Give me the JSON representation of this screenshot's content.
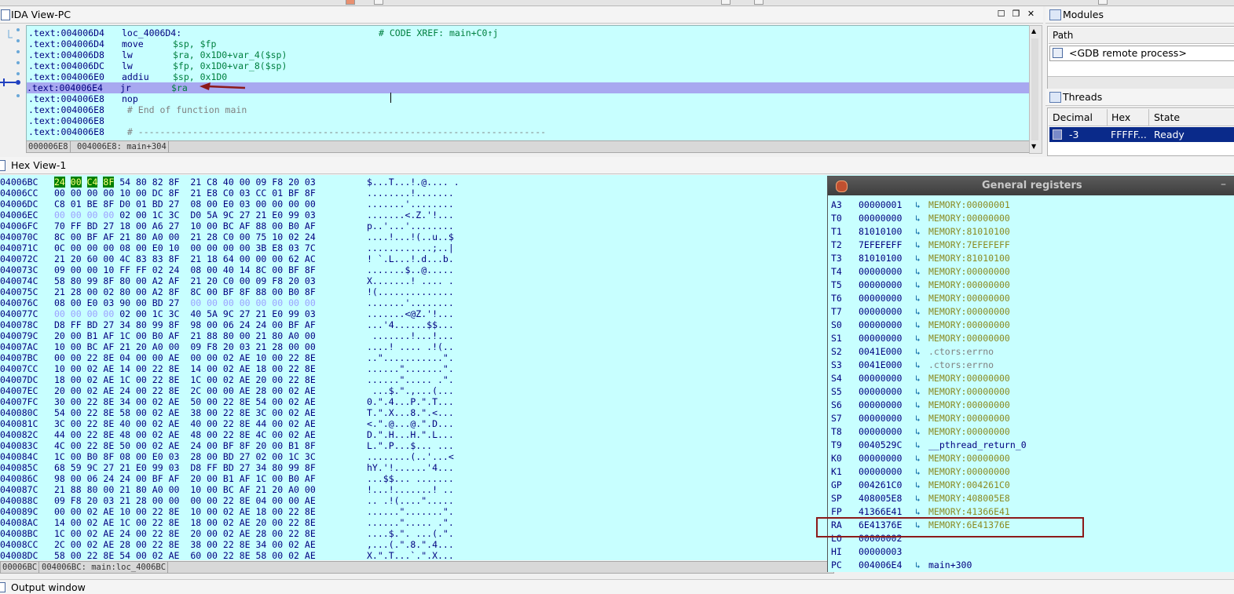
{
  "ida_view": {
    "title": "IDA View-PC",
    "lines": [
      {
        "addr": ".text:004006D4",
        "mnem": "loc_4006D4:",
        "ops": "",
        "comment": "# CODE XREF: main+C0↑j"
      },
      {
        "addr": ".text:004006D4",
        "mnem": "move",
        "ops": "$sp, $fp",
        "comment": ""
      },
      {
        "addr": ".text:004006D8",
        "mnem": "lw",
        "ops": "$ra, 0x1D0+var_4($sp)",
        "comment": ""
      },
      {
        "addr": ".text:004006DC",
        "mnem": "lw",
        "ops": "$fp, 0x1D0+var_8($sp)",
        "comment": ""
      },
      {
        "addr": ".text:004006E0",
        "mnem": "addiu",
        "ops": "$sp, 0x1D0",
        "comment": ""
      },
      {
        "addr": ".text:004006E4",
        "mnem": "jr",
        "ops": "$ra",
        "comment": ""
      },
      {
        "addr": ".text:004006E8",
        "mnem": "nop",
        "ops": "",
        "comment": ""
      },
      {
        "addr": ".text:004006E8",
        "mnem": "",
        "ops": "",
        "comment": " # End of function main"
      },
      {
        "addr": ".text:004006E8",
        "mnem": "",
        "ops": "",
        "comment": ""
      },
      {
        "addr": ".text:004006E8",
        "mnem": "",
        "ops": "",
        "comment": " # ---------------------------------------------------------------------------"
      }
    ],
    "selected_line": 5,
    "status": [
      "000006E8",
      "004006E8: main+304"
    ]
  },
  "modules": {
    "title": "Modules",
    "column": "Path",
    "rows": [
      "<GDB remote process>"
    ]
  },
  "threads": {
    "title": "Threads",
    "columns": [
      "Decimal",
      "Hex",
      "State"
    ],
    "rows": [
      {
        "decimal": "-3",
        "hex": "FFFFF...",
        "state": "Ready"
      }
    ]
  },
  "hex_view": {
    "title": "Hex View-1",
    "rows": [
      {
        "addr": "04006BC",
        "hex": "24 00 C4 8F 54 80 82 8F  21 C8 40 00 09 F8 20 03",
        "ascii": "$...T...!.@.... ."
      },
      {
        "addr": "04006CC",
        "hex": "00 00 00 00 10 00 DC 8F  21 E8 C0 03 CC 01 BF 8F",
        "ascii": "........!......."
      },
      {
        "addr": "04006DC",
        "hex": "C8 01 BE 8F D0 01 BD 27  08 00 E0 03 00 00 00 00",
        "ascii": ".......'........"
      },
      {
        "addr": "04006EC",
        "hex": "00 00 00 00 02 00 1C 3C  D0 5A 9C 27 21 E0 99 03",
        "ascii": ".......<.Z.'!..."
      },
      {
        "addr": "04006FC",
        "hex": "70 FF BD 27 18 00 A6 27  10 00 BC AF 88 00 B0 AF",
        "ascii": "p..'...'........"
      },
      {
        "addr": "040070C",
        "hex": "8C 00 BF AF 21 80 A0 00  21 28 C0 00 75 10 02 24",
        "ascii": "....!...!(..u..$"
      },
      {
        "addr": "040071C",
        "hex": "0C 00 00 00 08 00 E0 10  00 00 00 00 3B E8 03 7C",
        "ascii": "............;..|"
      },
      {
        "addr": "040072C",
        "hex": "21 20 60 00 4C 83 83 8F  21 18 64 00 00 00 62 AC",
        "ascii": "! `.L...!.d...b."
      },
      {
        "addr": "040073C",
        "hex": "09 00 00 10 FF FF 02 24  08 00 40 14 8C 00 BF 8F",
        "ascii": ".......$..@....."
      },
      {
        "addr": "040074C",
        "hex": "58 80 99 8F 80 00 A2 AF  21 20 C0 00 09 F8 20 03",
        "ascii": "X.......! .... ."
      },
      {
        "addr": "040075C",
        "hex": "21 28 00 02 80 00 A2 8F  8C 00 BF 8F 88 00 B0 8F",
        "ascii": "!(.............."
      },
      {
        "addr": "040076C",
        "hex": "08 00 E0 03 90 00 BD 27  00 00 00 00 00 00 00 00",
        "ascii": ".......'........"
      },
      {
        "addr": "040077C",
        "hex": "00 00 00 00 02 00 1C 3C  40 5A 9C 27 21 E0 99 03",
        "ascii": ".......<@Z.'!..."
      },
      {
        "addr": "040078C",
        "hex": "D8 FF BD 27 34 80 99 8F  98 00 06 24 24 00 BF AF",
        "ascii": "...'4......$$..."
      },
      {
        "addr": "040079C",
        "hex": "20 00 B1 AF 1C 00 B0 AF  21 88 80 00 21 80 A0 00",
        "ascii": " .......!...!..."
      },
      {
        "addr": "04007AC",
        "hex": "10 00 BC AF 21 20 A0 00  09 F8 20 03 21 28 00 00",
        "ascii": "....! .... .!(.."
      },
      {
        "addr": "04007BC",
        "hex": "00 00 22 8E 04 00 00 AE  00 00 02 AE 10 00 22 8E",
        "ascii": "..\"...........\"."
      },
      {
        "addr": "04007CC",
        "hex": "10 00 02 AE 14 00 22 8E  14 00 02 AE 18 00 22 8E",
        "ascii": "......\".......\"."
      },
      {
        "addr": "04007DC",
        "hex": "18 00 02 AE 1C 00 22 8E  1C 00 02 AE 20 00 22 8E",
        "ascii": "......\"..... .\"."
      },
      {
        "addr": "04007EC",
        "hex": "20 00 02 AE 24 00 22 8E  2C 00 00 AE 28 00 02 AE",
        "ascii": " ...$.\".,...(..."
      },
      {
        "addr": "04007FC",
        "hex": "30 00 22 8E 34 00 02 AE  50 00 22 8E 54 00 02 AE",
        "ascii": "0.\".4...P.\".T..."
      },
      {
        "addr": "040080C",
        "hex": "54 00 22 8E 58 00 02 AE  38 00 22 8E 3C 00 02 AE",
        "ascii": "T.\".X...8.\".<..."
      },
      {
        "addr": "040081C",
        "hex": "3C 00 22 8E 40 00 02 AE  40 00 22 8E 44 00 02 AE",
        "ascii": "<.\".@...@.\".D..."
      },
      {
        "addr": "040082C",
        "hex": "44 00 22 8E 48 00 02 AE  48 00 22 8E 4C 00 02 AE",
        "ascii": "D.\".H...H.\".L..."
      },
      {
        "addr": "040083C",
        "hex": "4C 00 22 8E 50 00 02 AE  24 00 BF 8F 20 00 B1 8F",
        "ascii": "L.\".P...$... ..."
      },
      {
        "addr": "040084C",
        "hex": "1C 00 B0 8F 08 00 E0 03  28 00 BD 27 02 00 1C 3C",
        "ascii": "........(..'...<"
      },
      {
        "addr": "040085C",
        "hex": "68 59 9C 27 21 E0 99 03  D8 FF BD 27 34 80 99 8F",
        "ascii": "hY.'!......'4..."
      },
      {
        "addr": "040086C",
        "hex": "98 00 06 24 24 00 BF AF  20 00 B1 AF 1C 00 B0 AF",
        "ascii": "...$$... ......."
      },
      {
        "addr": "040087C",
        "hex": "21 88 80 00 21 80 A0 00  10 00 BC AF 21 20 A0 00",
        "ascii": "!...!.......! .."
      },
      {
        "addr": "040088C",
        "hex": "09 F8 20 03 21 28 00 00  00 00 22 8E 04 00 00 AE",
        "ascii": ".. .!(....\"....."
      },
      {
        "addr": "040089C",
        "hex": "00 00 02 AE 10 00 22 8E  10 00 02 AE 18 00 22 8E",
        "ascii": "......\".......\"."
      },
      {
        "addr": "04008AC",
        "hex": "14 00 02 AE 1C 00 22 8E  18 00 02 AE 20 00 22 8E",
        "ascii": "......\"..... .\"."
      },
      {
        "addr": "04008BC",
        "hex": "1C 00 02 AE 24 00 22 8E  20 00 02 AE 28 00 22 8E",
        "ascii": "....$.\". ...(.\"."
      },
      {
        "addr": "04008CC",
        "hex": "2C 00 02 AE 28 00 22 8E  38 00 22 8E 34 00 02 AE",
        "ascii": ",...(.\".8.\".4..."
      },
      {
        "addr": "04008DC",
        "hex": "58 00 22 8E 54 00 02 AE  60 00 22 8E 58 00 02 AE",
        "ascii": "X.\".T...`.\".X..."
      }
    ],
    "status": [
      "00006BC",
      "004006BC: main:loc_4006BC"
    ]
  },
  "registers": {
    "title": "General registers",
    "rows": [
      {
        "name": "A3",
        "value": "00000001",
        "desc": "MEMORY:00000001",
        "kind": "mem"
      },
      {
        "name": "T0",
        "value": "00000000",
        "desc": "MEMORY:00000000",
        "kind": "mem"
      },
      {
        "name": "T1",
        "value": "81010100",
        "desc": "MEMORY:81010100",
        "kind": "mem"
      },
      {
        "name": "T2",
        "value": "7EFEFEFF",
        "desc": "MEMORY:7EFEFEFF",
        "kind": "mem"
      },
      {
        "name": "T3",
        "value": "81010100",
        "desc": "MEMORY:81010100",
        "kind": "mem"
      },
      {
        "name": "T4",
        "value": "00000000",
        "desc": "MEMORY:00000000",
        "kind": "mem"
      },
      {
        "name": "T5",
        "value": "00000000",
        "desc": "MEMORY:00000000",
        "kind": "mem"
      },
      {
        "name": "T6",
        "value": "00000000",
        "desc": "MEMORY:00000000",
        "kind": "mem"
      },
      {
        "name": "T7",
        "value": "00000000",
        "desc": "MEMORY:00000000",
        "kind": "mem"
      },
      {
        "name": "S0",
        "value": "00000000",
        "desc": "MEMORY:00000000",
        "kind": "mem"
      },
      {
        "name": "S1",
        "value": "00000000",
        "desc": "MEMORY:00000000",
        "kind": "mem"
      },
      {
        "name": "S2",
        "value": "0041E000",
        "desc": ".ctors:errno",
        "kind": "seg"
      },
      {
        "name": "S3",
        "value": "0041E000",
        "desc": ".ctors:errno",
        "kind": "seg"
      },
      {
        "name": "S4",
        "value": "00000000",
        "desc": "MEMORY:00000000",
        "kind": "mem"
      },
      {
        "name": "S5",
        "value": "00000000",
        "desc": "MEMORY:00000000",
        "kind": "mem"
      },
      {
        "name": "S6",
        "value": "00000000",
        "desc": "MEMORY:00000000",
        "kind": "mem"
      },
      {
        "name": "S7",
        "value": "00000000",
        "desc": "MEMORY:00000000",
        "kind": "mem"
      },
      {
        "name": "T8",
        "value": "00000000",
        "desc": "MEMORY:00000000",
        "kind": "mem"
      },
      {
        "name": "T9",
        "value": "0040529C",
        "desc": "__pthread_return_0",
        "kind": "sym"
      },
      {
        "name": "K0",
        "value": "00000000",
        "desc": "MEMORY:00000000",
        "kind": "mem"
      },
      {
        "name": "K1",
        "value": "00000000",
        "desc": "MEMORY:00000000",
        "kind": "mem"
      },
      {
        "name": "GP",
        "value": "004261C0",
        "desc": "MEMORY:004261C0",
        "kind": "mem"
      },
      {
        "name": "SP",
        "value": "408005E8",
        "desc": "MEMORY:408005E8",
        "kind": "mem"
      },
      {
        "name": "FP",
        "value": "41366E41",
        "desc": "MEMORY:41366E41",
        "kind": "mem"
      },
      {
        "name": "RA",
        "value": "6E41376E",
        "desc": "MEMORY:6E41376E",
        "kind": "mem"
      },
      {
        "name": "LO",
        "value": "00000002",
        "desc": "",
        "kind": "none"
      },
      {
        "name": "HI",
        "value": "00000003",
        "desc": "",
        "kind": "none"
      },
      {
        "name": "PC",
        "value": "004006E4",
        "desc": "main+300",
        "kind": "sym"
      }
    ]
  },
  "output": {
    "title": "Output window"
  },
  "colors": {
    "code_bg": "#c8ffff",
    "selected_line": "#a8a8f0",
    "highlight_box": "#8b1a1a",
    "arrow": "#8b1a1a"
  }
}
